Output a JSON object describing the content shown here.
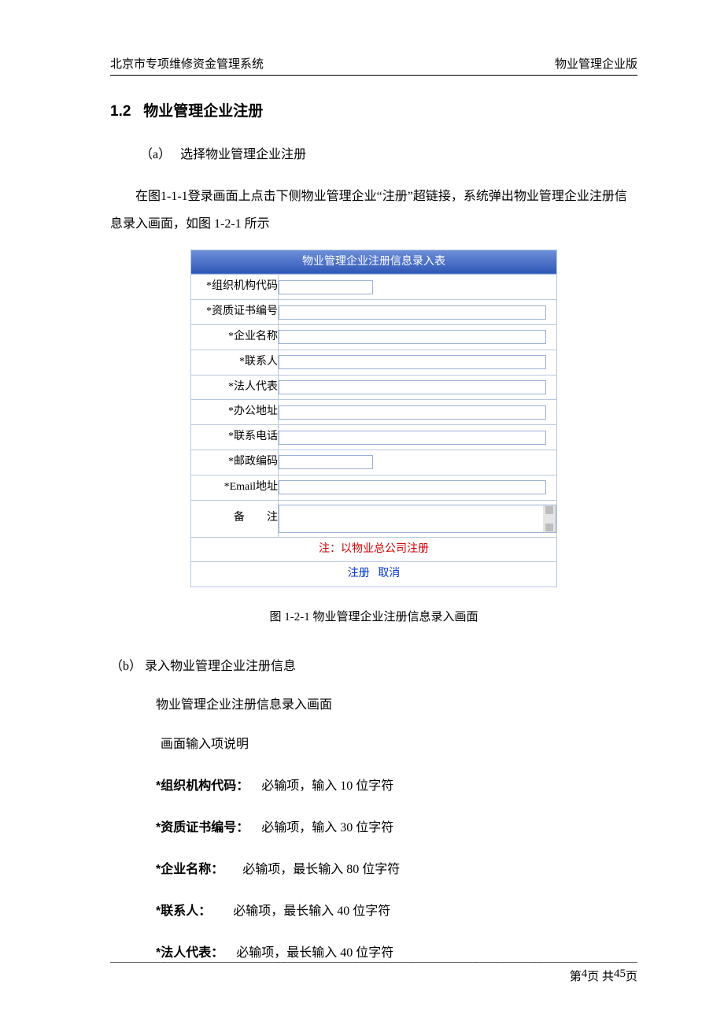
{
  "header": {
    "left": "北京市专项维修资金管理系统",
    "right": "物业管理企业版"
  },
  "section": {
    "number": "1.2",
    "title": "物业管理企业注册"
  },
  "step_a": {
    "marker": "（a）",
    "title": "选择物业管理企业注册",
    "paragraph": "在图1-1-1登录画面上点击下侧物业管理企业“注册”超链接，系统弹出物业管理企业注册信息录入画面，如图 1-2-1 所示"
  },
  "form": {
    "title": "物业管理企业注册信息录入表",
    "fields": [
      {
        "label": "*组织机构代码"
      },
      {
        "label": "*资质证书编号"
      },
      {
        "label": "*企业名称"
      },
      {
        "label": "*联系人"
      },
      {
        "label": "*法人代表"
      },
      {
        "label": "*办公地址"
      },
      {
        "label": "*联系电话"
      },
      {
        "label": "*邮政编码"
      },
      {
        "label": "*Email地址"
      }
    ],
    "memo_label": "备　　注",
    "note": "注：以物业总公司注册",
    "btn_register": "注册",
    "btn_cancel": "取消"
  },
  "caption": "图 1-2-1 物业管理企业注册信息录入画面",
  "step_b": {
    "marker": "（b）",
    "title": "录入物业管理企业注册信息",
    "line1": "物业管理企业注册信息录入画面",
    "line2": "画面输入项说明",
    "specs": [
      {
        "label": "*组织机构代码：",
        "desc": "必输项，输入 10 位字符"
      },
      {
        "label": "*资质证书编号：",
        "desc": "必输项，输入 30 位字符"
      },
      {
        "label": "*企业名称：",
        "desc": "必输项，最长输入 80 位字符"
      },
      {
        "label": "*联系人：",
        "desc": "必输项，最长输入 40 位字符"
      },
      {
        "label": "*法人代表：",
        "desc": "必输项，最长输入 40 位字符"
      }
    ]
  },
  "footer": {
    "prefix": "第 ",
    "page": "4",
    "mid": " 页 共 ",
    "total": "45",
    "suffix": " 页"
  }
}
